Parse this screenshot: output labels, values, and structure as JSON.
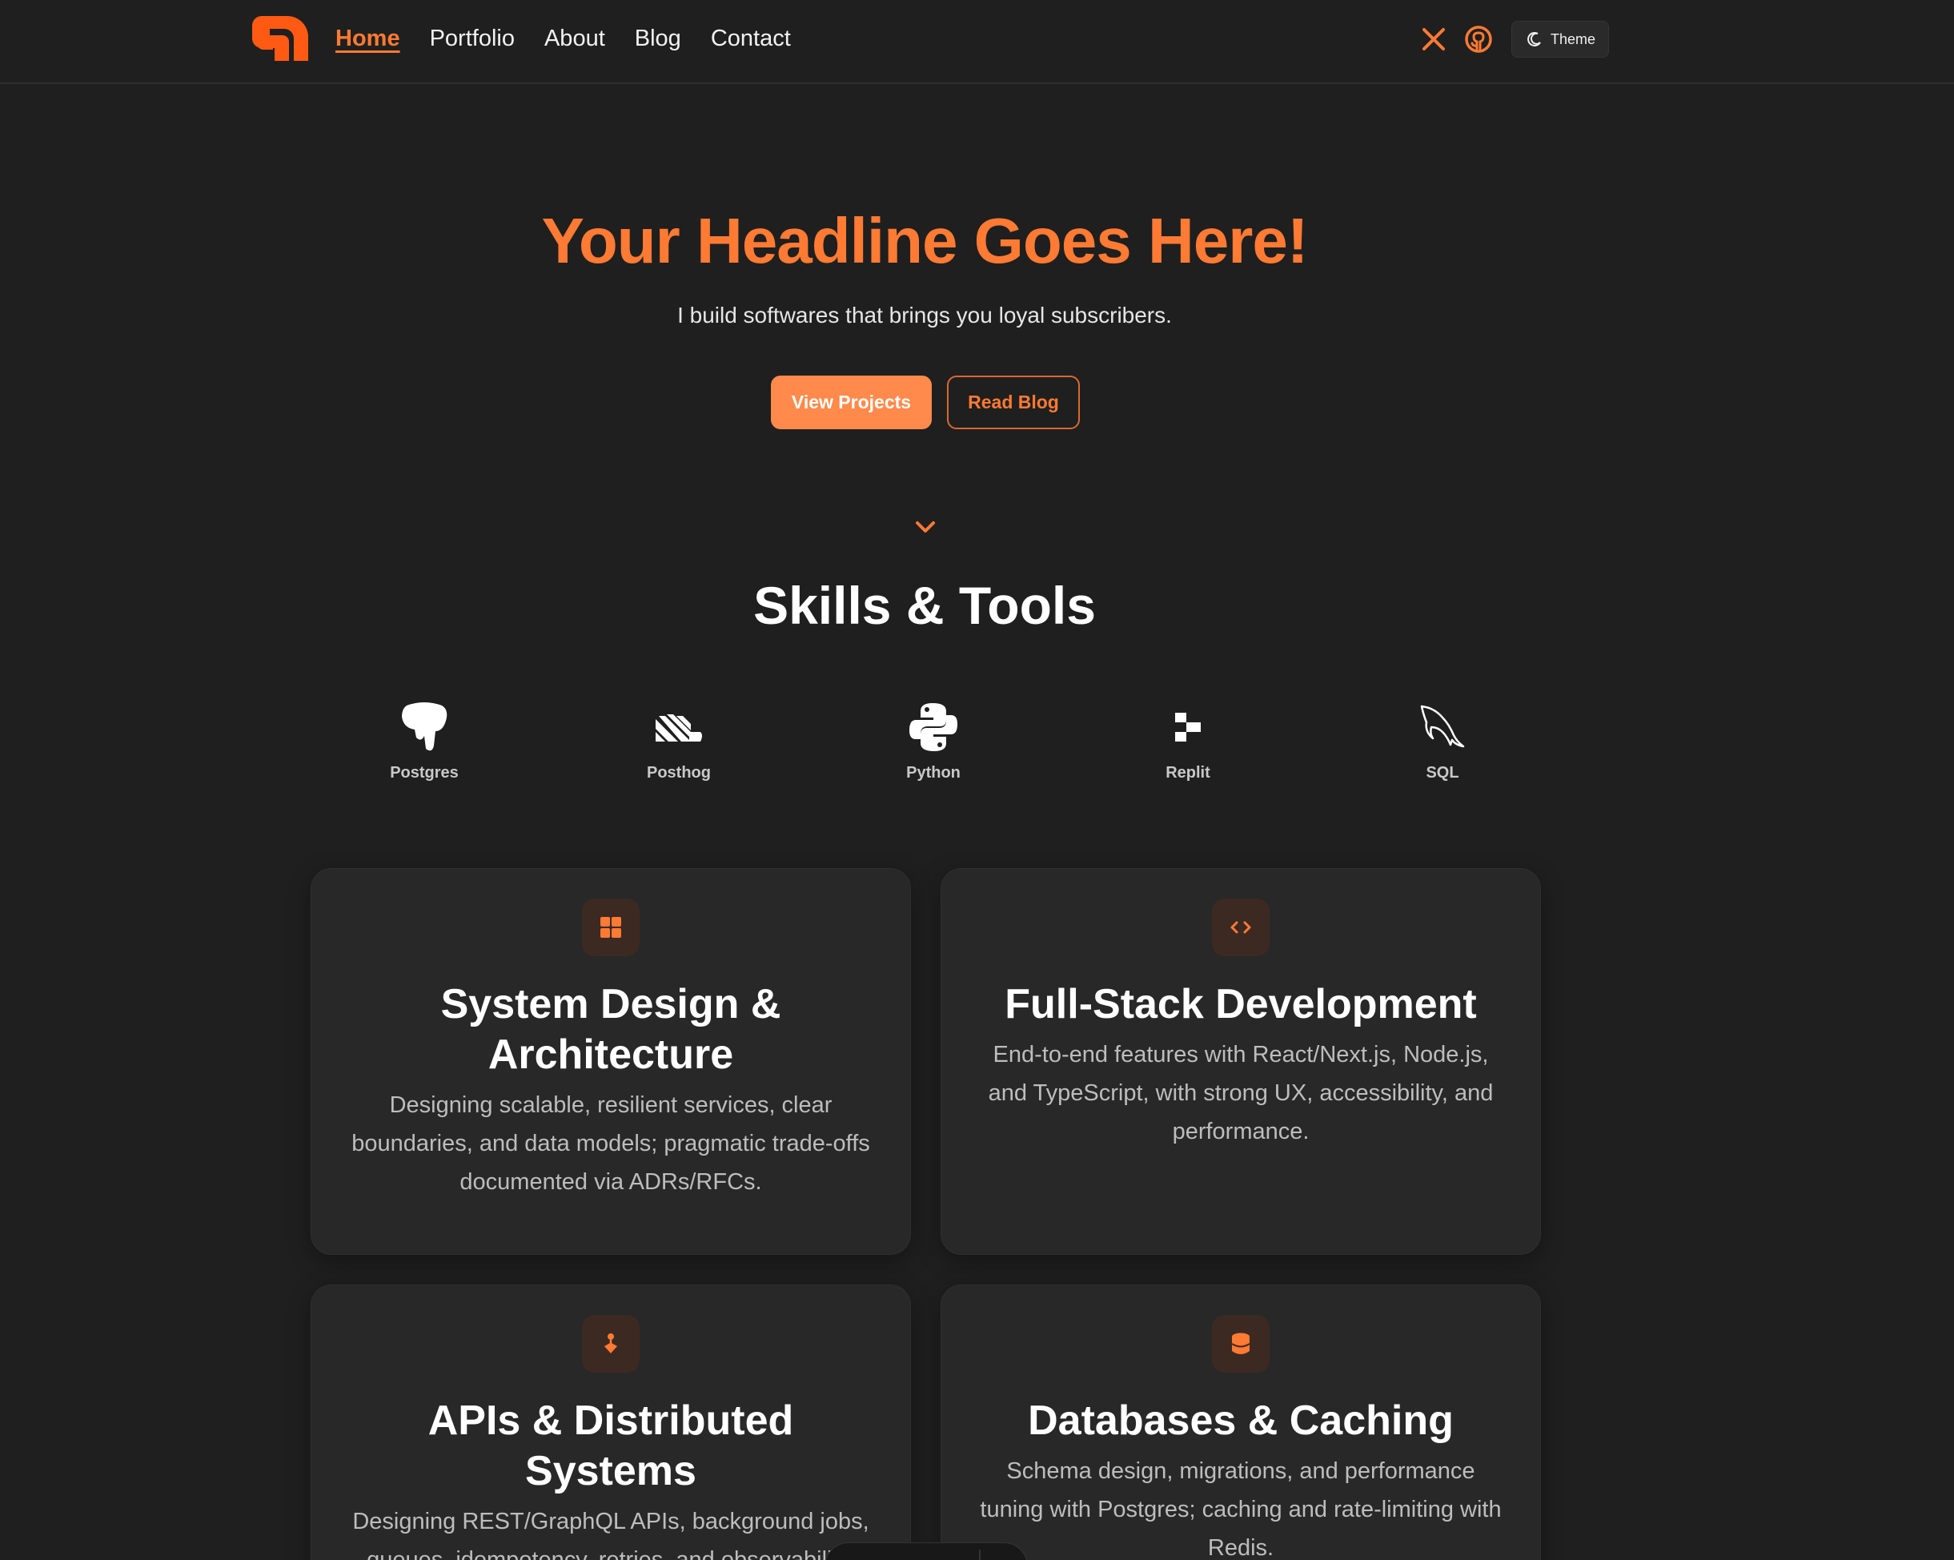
{
  "nav": {
    "links": [
      {
        "label": "Home",
        "active": true
      },
      {
        "label": "Portfolio",
        "active": false
      },
      {
        "label": "About",
        "active": false
      },
      {
        "label": "Blog",
        "active": false
      },
      {
        "label": "Contact",
        "active": false
      }
    ],
    "social_icons": [
      "x-icon",
      "github-icon"
    ],
    "theme_label": "Theme"
  },
  "hero": {
    "title": "Your Headline Goes Here!",
    "subtitle": "I build softwares that brings you loyal subscribers.",
    "primary_button": "View Projects",
    "secondary_button": "Read Blog"
  },
  "skills": {
    "title": "Skills & Tools",
    "items": [
      {
        "label": "Postgres",
        "icon": "postgres-icon"
      },
      {
        "label": "Posthog",
        "icon": "posthog-icon"
      },
      {
        "label": "Python",
        "icon": "python-icon"
      },
      {
        "label": "Replit",
        "icon": "replit-icon"
      },
      {
        "label": "SQL",
        "icon": "mysql-dolphin-icon"
      }
    ]
  },
  "cards": [
    {
      "icon": "grid-icon",
      "title": "System Design & Architecture",
      "description": "Designing scalable, resilient services, clear boundaries, and data models; pragmatic trade-offs documented via ADRs/RFCs."
    },
    {
      "icon": "code-icon",
      "title": "Full-Stack Development",
      "description": "End-to-end features with React/Next.js, Node.js, and TypeScript, with strong UX, accessibility, and performance."
    },
    {
      "icon": "network-icon",
      "title": "APIs & Distributed Systems",
      "description": "Designing REST/GraphQL APIs, background jobs, queues, idempotency, retries, and observability."
    },
    {
      "icon": "database-icon",
      "title": "Databases & Caching",
      "description": "Schema design, migrations, and performance tuning with Postgres; caching and rate-limiting with Redis."
    }
  ],
  "colors": {
    "accent": "#ff7a33",
    "background": "#1f1f1f",
    "card": "#282828"
  }
}
